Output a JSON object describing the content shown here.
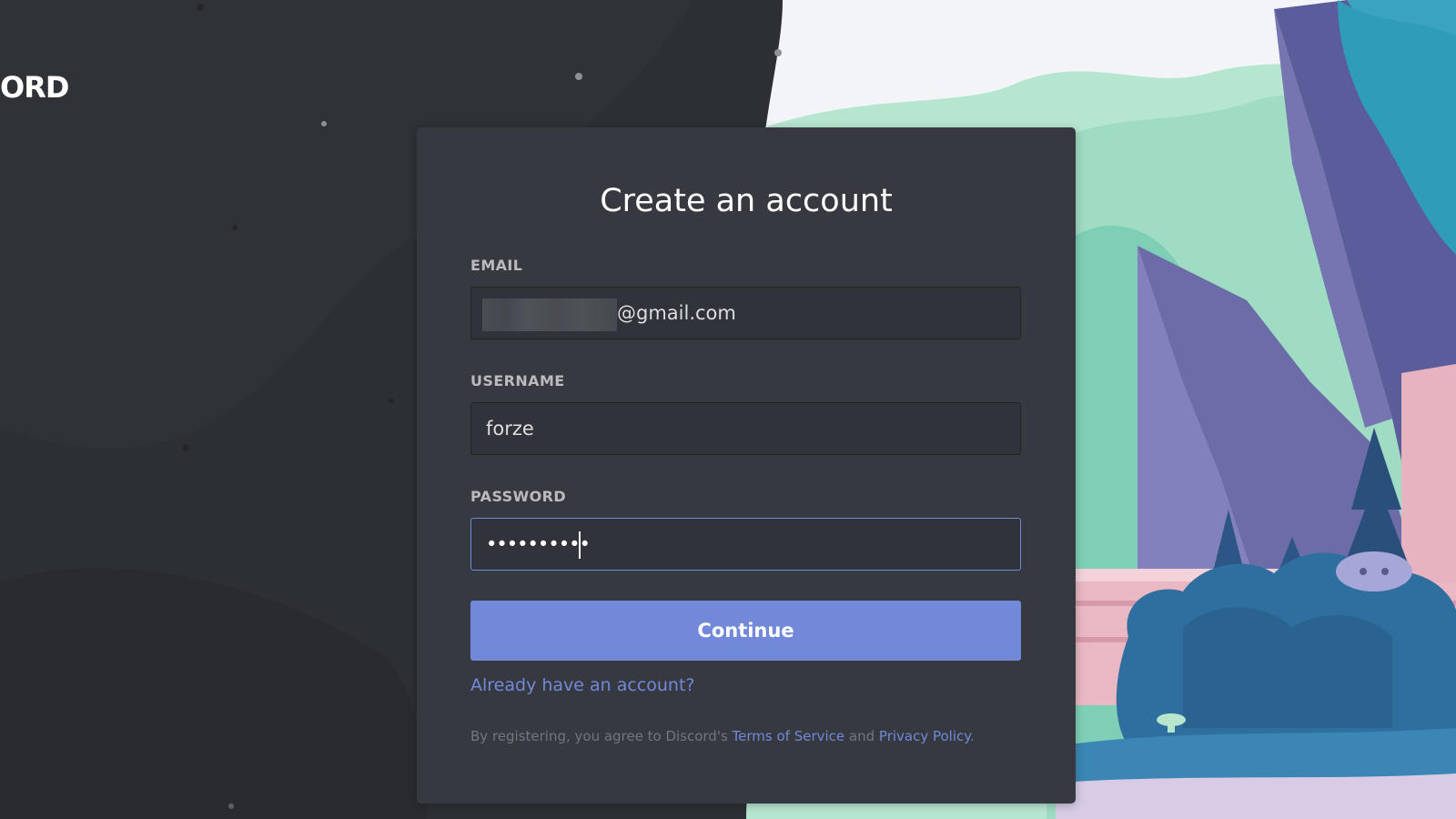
{
  "brand": {
    "logo_text": "ORD"
  },
  "form": {
    "title": "Create an account",
    "email": {
      "label": "EMAIL",
      "value_suffix": "@gmail.com"
    },
    "username": {
      "label": "USERNAME",
      "value": "forze"
    },
    "password": {
      "label": "PASSWORD",
      "masked_value": "••••••••••"
    },
    "continue_label": "Continue",
    "login_link": "Already have an account?",
    "legal": {
      "prefix": "By registering, you agree to Discord's ",
      "terms": "Terms of Service",
      "and": " and ",
      "privacy": "Privacy Policy",
      "suffix": "."
    }
  },
  "colors": {
    "accent": "#7289da",
    "card": "#36393f",
    "page_background": "#2c2f33",
    "input_background": "#303339"
  }
}
